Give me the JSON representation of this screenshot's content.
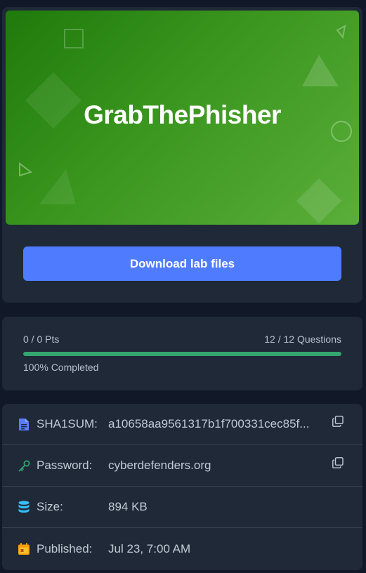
{
  "lab": {
    "banner_title": "GrabThePhisher",
    "download_label": "Download lab files"
  },
  "progress": {
    "points_text": "0 / 0 Pts",
    "questions_text": "12 / 12 Questions",
    "completed_text": "100% Completed",
    "percent": 100
  },
  "info": {
    "sha1": {
      "label": "SHA1SUM:",
      "value": "a10658aa9561317b1f700331cec85f..."
    },
    "password": {
      "label": "Password:",
      "value": "cyberdefenders.org"
    },
    "size": {
      "label": "Size:",
      "value": "894 KB"
    },
    "published": {
      "label": "Published:",
      "value": "Jul 23, 7:00 AM"
    }
  },
  "icons": {
    "sha1": "file-icon",
    "password": "key-icon",
    "size": "database-icon",
    "published": "calendar-icon",
    "copy": "copy-icon"
  },
  "colors": {
    "background": "#111827",
    "card": "#1f2937",
    "accent_button": "#4f7cff",
    "progress_fill": "#34a56f",
    "banner_green": "#3a961e",
    "file_icon": "#5b7cfa",
    "key_icon": "#34a56f",
    "database_icon": "#38bdf8",
    "calendar_icon": "#f59e0b"
  }
}
